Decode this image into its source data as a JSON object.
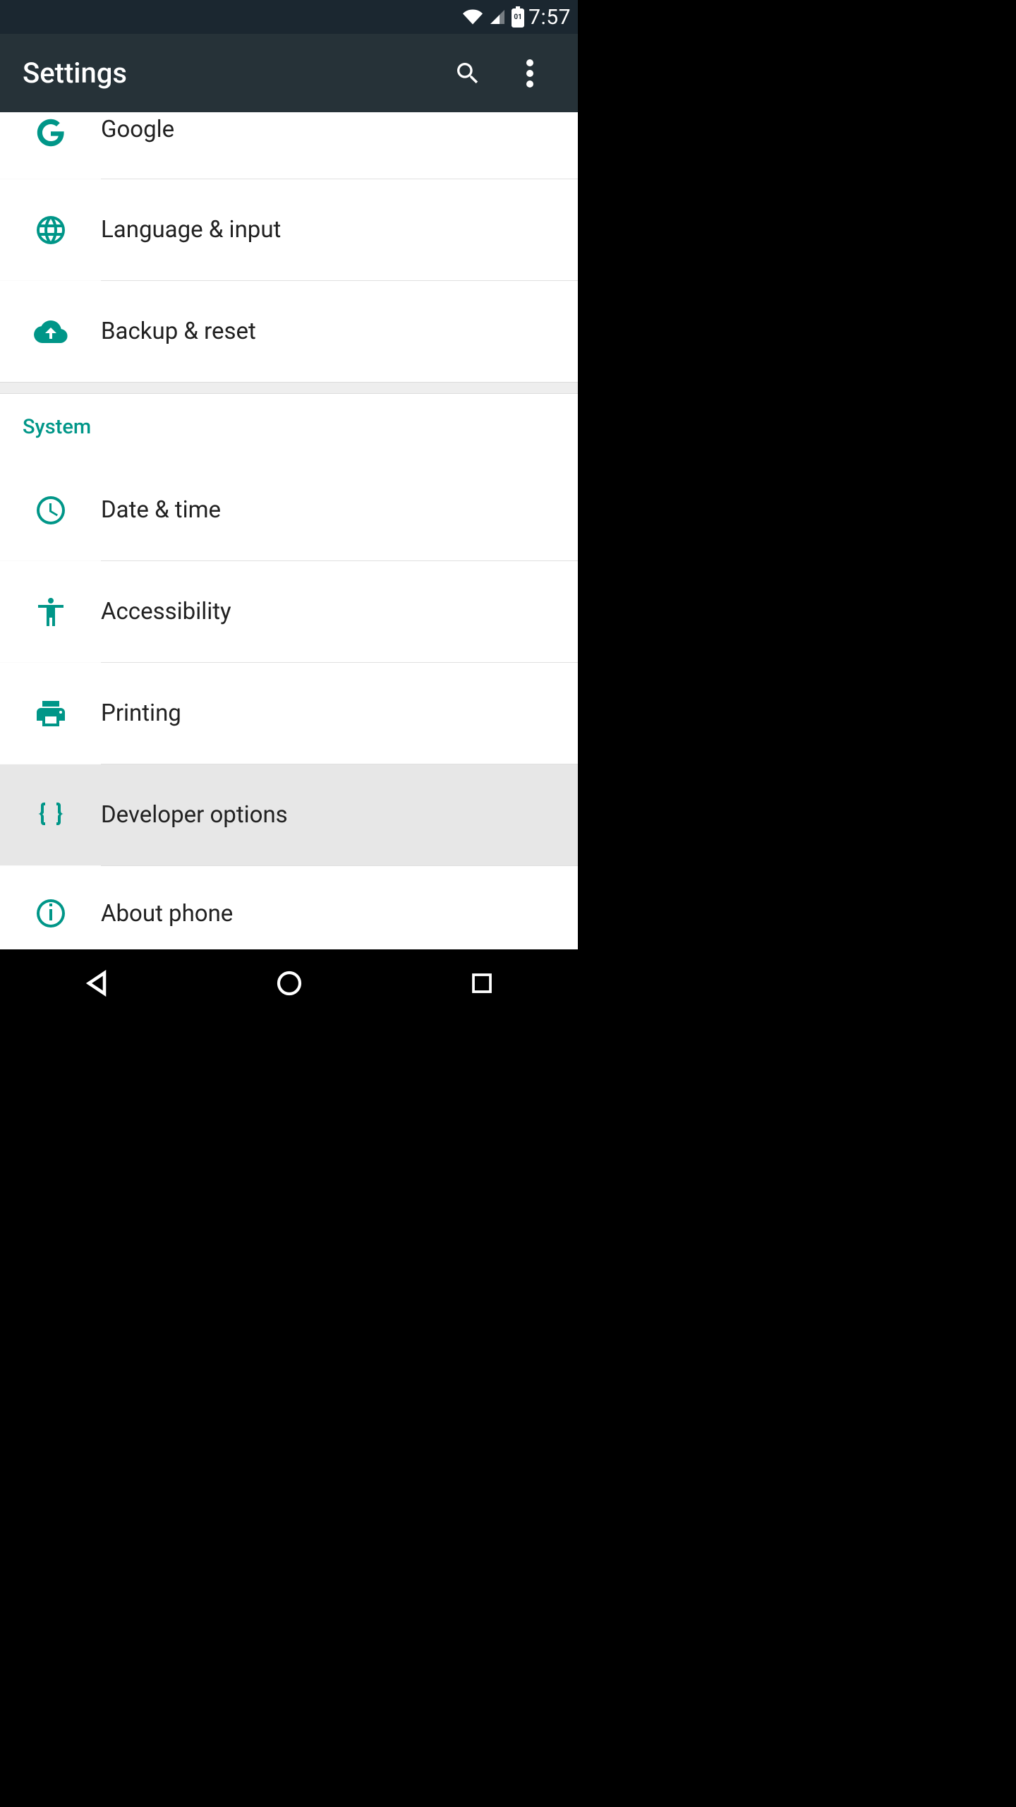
{
  "status": {
    "time": "7:57",
    "battery_text": "01"
  },
  "appbar": {
    "title": "Settings"
  },
  "items_top": [
    {
      "icon": "google-icon",
      "label": "Google"
    },
    {
      "icon": "globe-icon",
      "label": "Language & input"
    },
    {
      "icon": "cloud-upload-icon",
      "label": "Backup & reset"
    }
  ],
  "section": {
    "label": "System"
  },
  "items_system": [
    {
      "icon": "clock-icon",
      "label": "Date & time",
      "highlight": false
    },
    {
      "icon": "accessibility-icon",
      "label": "Accessibility",
      "highlight": false
    },
    {
      "icon": "print-icon",
      "label": "Printing",
      "highlight": false
    },
    {
      "icon": "braces-icon",
      "label": "Developer options",
      "highlight": true
    },
    {
      "icon": "info-icon",
      "label": "About phone",
      "highlight": false
    }
  ]
}
